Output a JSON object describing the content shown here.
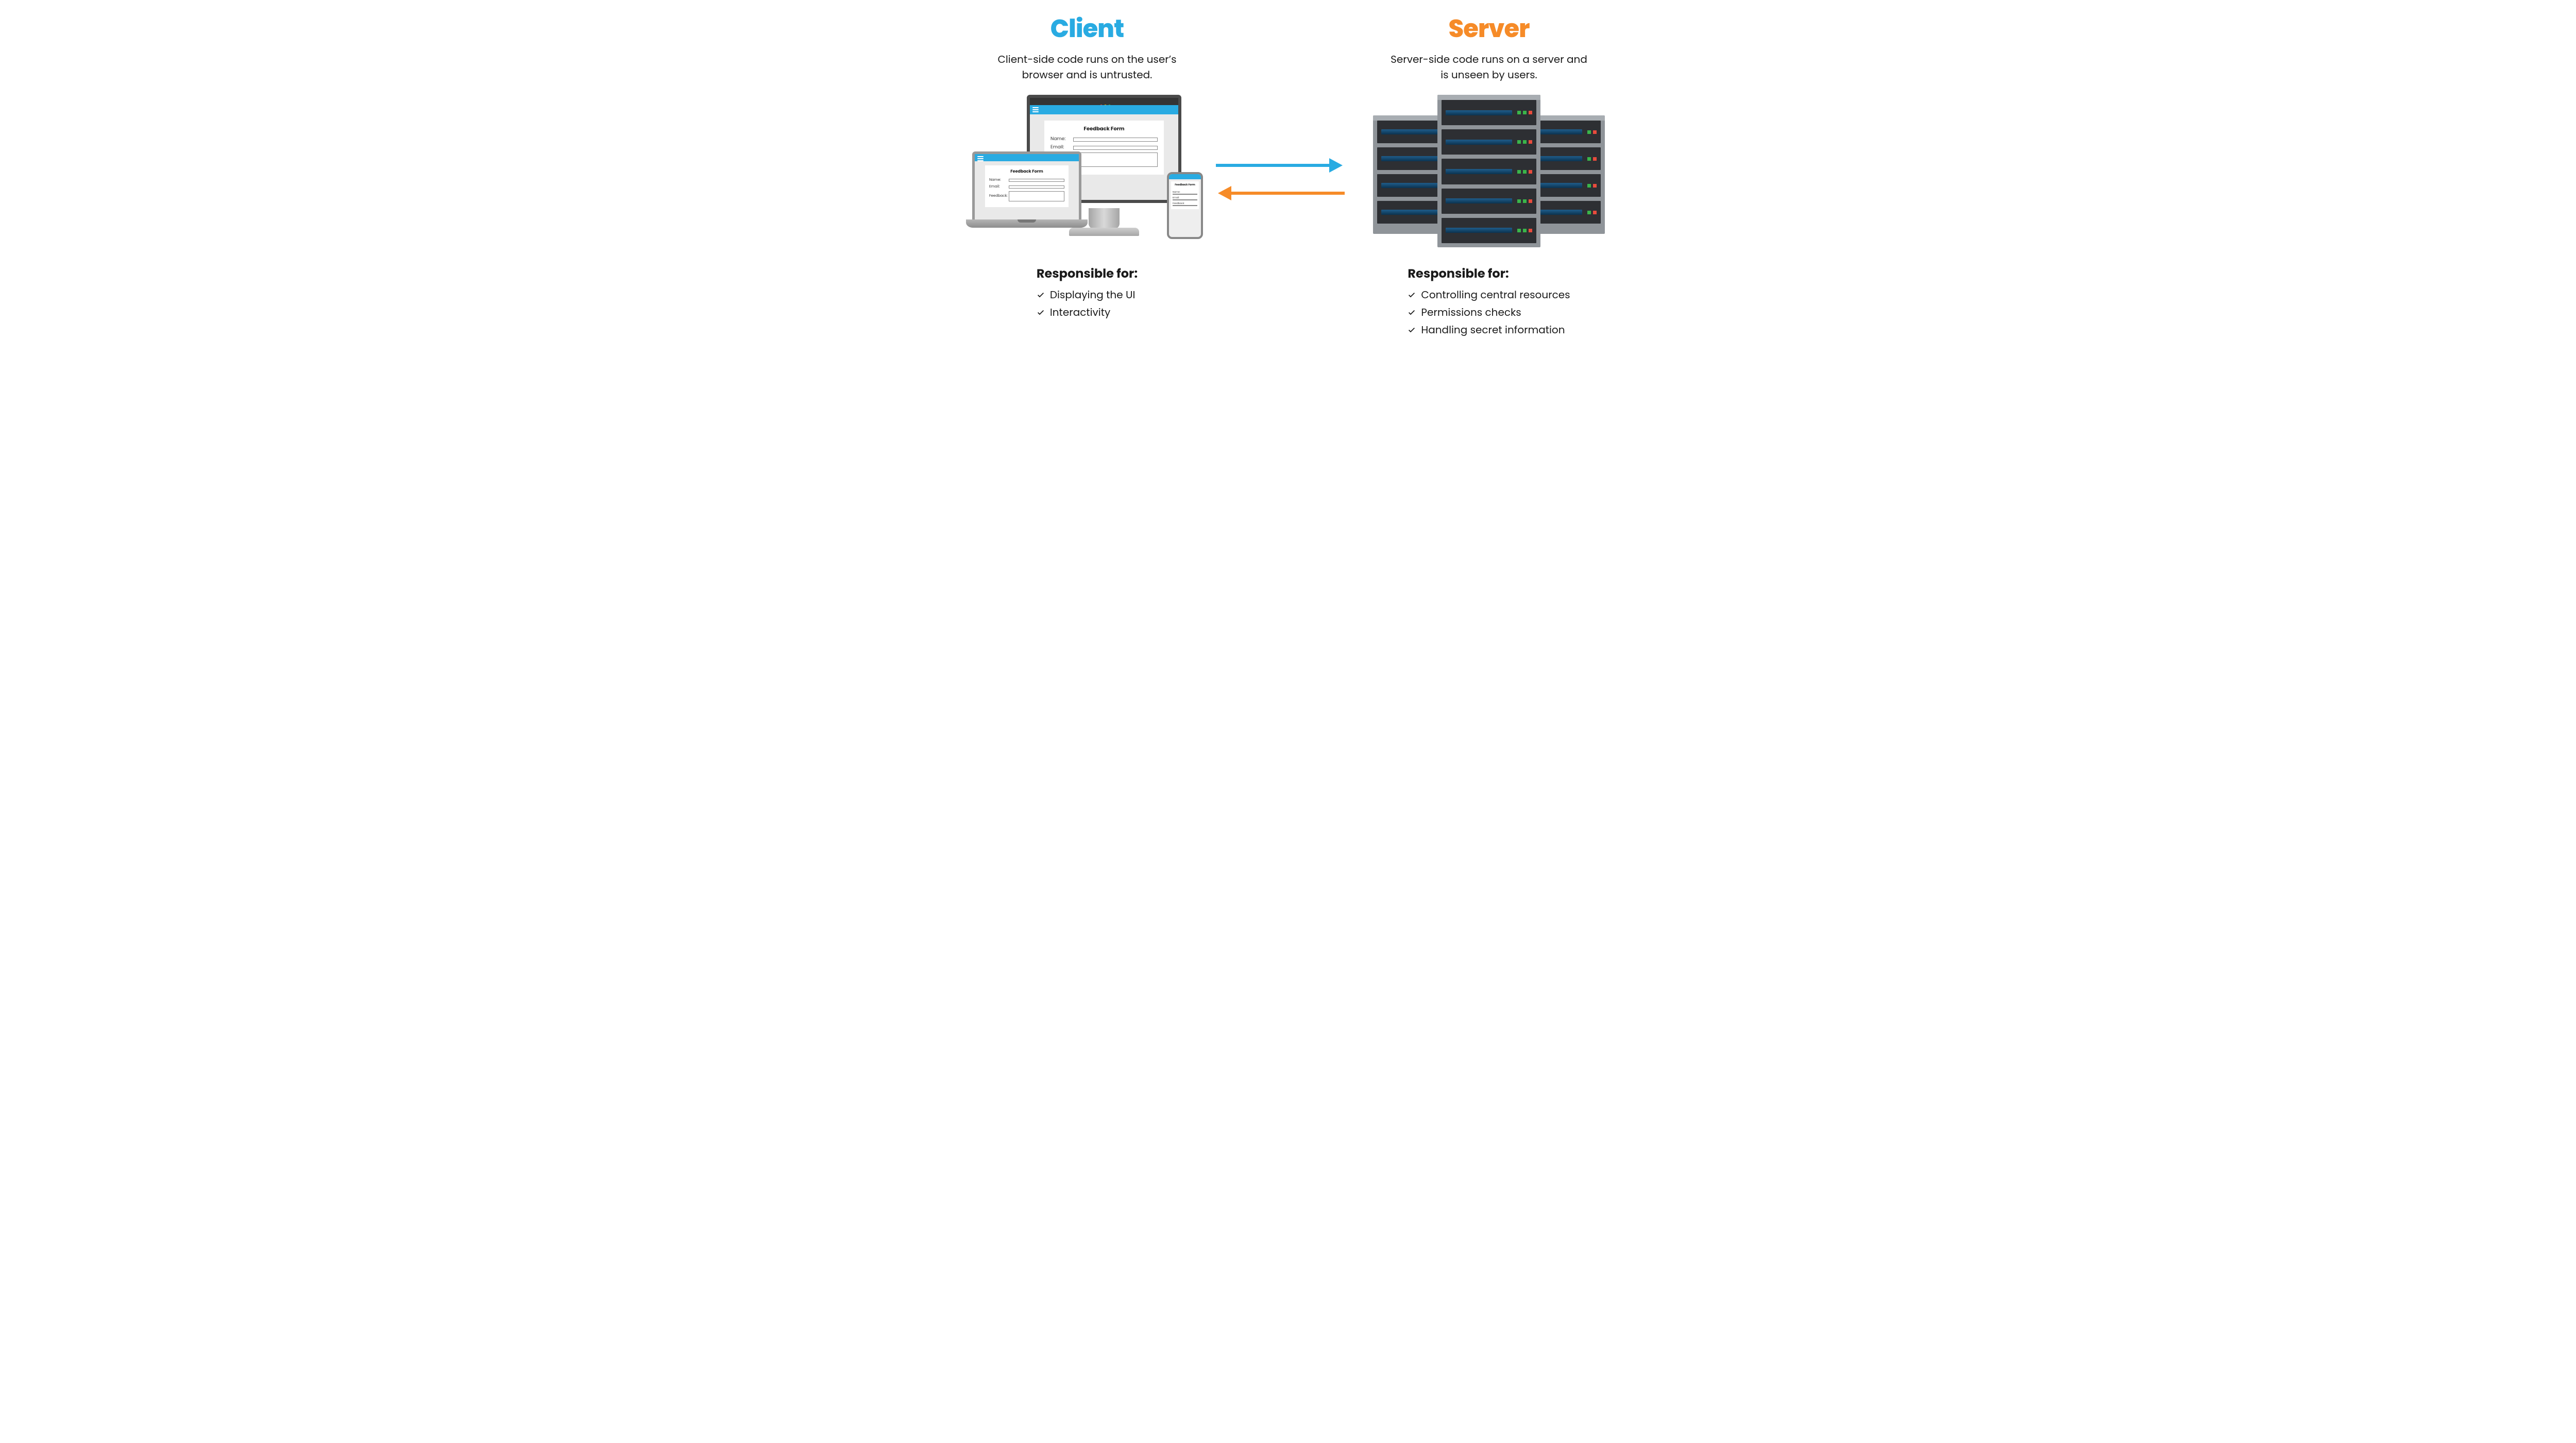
{
  "client": {
    "title": "Client",
    "subtitle": "Client-side code runs on the user’s browser and is untrusted.",
    "form_title": "Feedback Form",
    "fields": {
      "name": "Name:",
      "email": "Email:",
      "feedback": "Feedback:"
    },
    "responsible_heading": "Responsible for:",
    "responsibilities": [
      "Displaying the UI",
      "Interactivity"
    ]
  },
  "server": {
    "title": "Server",
    "subtitle": "Server-side code runs on a server and is unseen by users.",
    "responsible_heading": "Responsible for:",
    "responsibilities": [
      "Controlling central resources",
      "Permissions checks",
      "Handling secret information"
    ]
  },
  "colors": {
    "client": "#29abe2",
    "server": "#f68b28"
  }
}
